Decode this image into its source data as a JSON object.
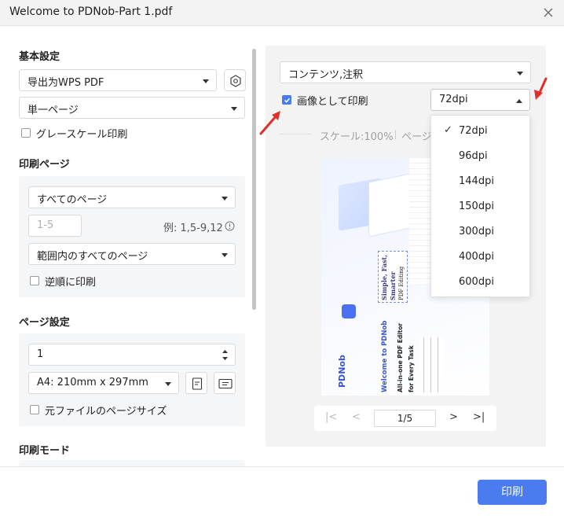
{
  "window": {
    "title": "Welcome to PDNob-Part 1.pdf"
  },
  "basic": {
    "title": "基本設定",
    "printer": "导出为WPS PDF",
    "page_mode": "単一ページ",
    "grayscale_label": "グレースケール印刷",
    "grayscale_checked": false
  },
  "print_pages": {
    "title": "印刷ページ",
    "range": "すべてのページ",
    "custom_placeholder": "1-5",
    "example": "例: 1,5-9,12",
    "subset": "範囲内のすべてのページ",
    "reverse_label": "逆順に印刷",
    "reverse_checked": false
  },
  "page_setup": {
    "title": "ページ設定",
    "copies": "1",
    "paper": "A4: 210mm x 297mm",
    "original_size_label": "元ファイルのページサイズ",
    "original_size_checked": false
  },
  "print_mode": {
    "title": "印刷モード"
  },
  "right": {
    "content": "コンテンツ,注釈",
    "print_as_image_label": "画像として印刷",
    "print_as_image_checked": true,
    "dpi_selected": "72dpi",
    "scale_label": "スケール:100%",
    "page_label_partial": "ページ"
  },
  "dpi_menu": {
    "options": [
      "72dpi",
      "96dpi",
      "144dpi",
      "150dpi",
      "300dpi",
      "400dpi",
      "600dpi"
    ],
    "selected": "72dpi"
  },
  "preview": {
    "brand": "PDNob",
    "welcome": "Welcome to PDNob",
    "tagline_1": "All-in-one PDF Editor",
    "tagline_2": "for Every Task",
    "callout_1": "Simple, Fast,",
    "callout_2": "Smarter",
    "callout_3": "PDF Editing"
  },
  "pager": {
    "page_display": "1/5"
  },
  "footer": {
    "print_label": "印刷"
  },
  "colors": {
    "accent": "#4a7cf0",
    "arrow": "#e0302a"
  }
}
